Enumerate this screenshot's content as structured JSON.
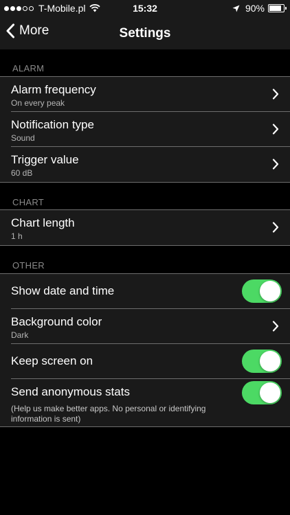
{
  "status_bar": {
    "carrier": "T-Mobile.pl",
    "time": "15:32",
    "battery": "90%",
    "battery_level": 0.9,
    "signal_bars": 3,
    "signal_total": 5,
    "icons": [
      "wifi-icon",
      "location-arrow-icon",
      "battery-icon"
    ]
  },
  "nav": {
    "back_label": "More",
    "title": "Settings"
  },
  "sections": {
    "alarm": {
      "header": "ALARM",
      "frequency": {
        "title": "Alarm frequency",
        "value": "On every peak"
      },
      "notification": {
        "title": "Notification type",
        "value": "Sound"
      },
      "trigger": {
        "title": "Trigger value",
        "value": "60 dB"
      }
    },
    "chart": {
      "header": "CHART",
      "length": {
        "title": "Chart length",
        "value": "1 h"
      }
    },
    "other": {
      "header": "OTHER",
      "show_date": {
        "title": "Show date and time",
        "on": true
      },
      "background": {
        "title": "Background color",
        "value": "Dark"
      },
      "keep_screen": {
        "title": "Keep screen on",
        "on": true
      },
      "stats": {
        "title": "Send anonymous stats",
        "note": "(Help us make better apps. No personal or identifying information is sent)",
        "on": true
      }
    }
  },
  "colors": {
    "background": "#000000",
    "cell_background": "#1a1a1a",
    "toggle_on": "#4cd964",
    "section_header": "#8a8a8a"
  }
}
